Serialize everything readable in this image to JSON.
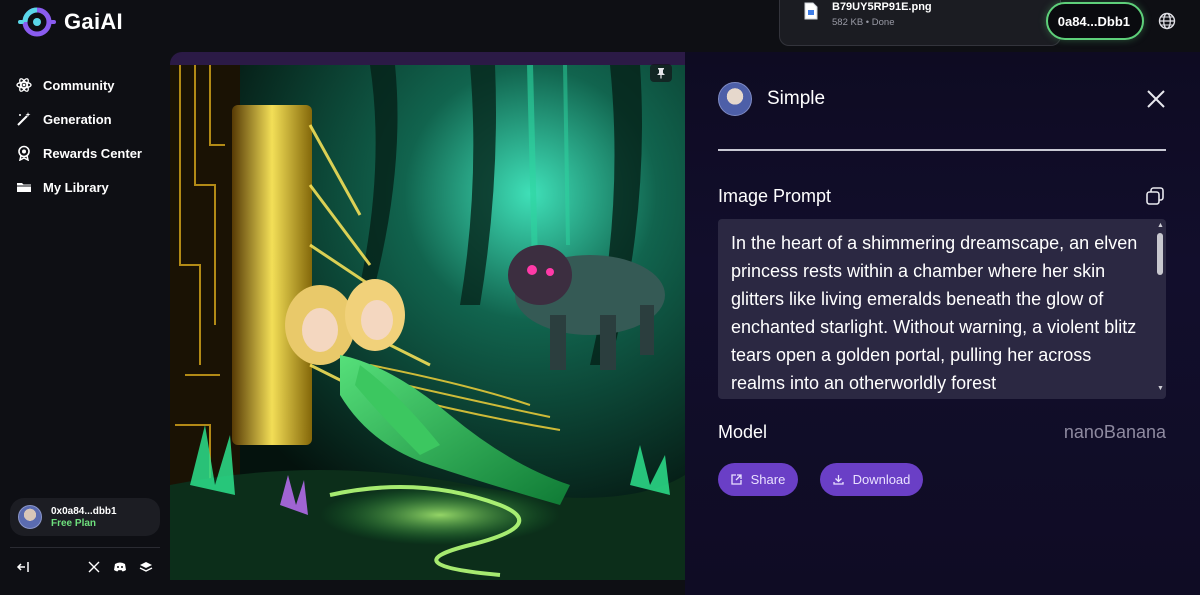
{
  "app": {
    "name": "GaiAI"
  },
  "download_popup": {
    "filename": "B79UY5RP91E.png",
    "meta": "582 KB • Done"
  },
  "header": {
    "wallet_label": "0a84...Dbb1"
  },
  "sidebar": {
    "items": [
      {
        "label": "Community",
        "icon": "atom-icon"
      },
      {
        "label": "Generation",
        "icon": "magic-wand-icon"
      },
      {
        "label": "Rewards Center",
        "icon": "medal-icon"
      },
      {
        "label": "My Library",
        "icon": "folder-icon"
      }
    ],
    "user": {
      "address": "0x0a84...dbb1",
      "plan": "Free Plan"
    },
    "footer_icons": [
      "collapse-icon",
      "x-icon",
      "discord-icon",
      "layers-icon"
    ]
  },
  "detail": {
    "style_name": "Simple",
    "prompt_label": "Image Prompt",
    "prompt_text": "In the heart of a shimmering dreamscape, an elven princess rests within a chamber where her skin glitters like living emeralds beneath the glow of enchanted starlight. Without warning, a violent blitz tears open a golden portal, pulling her across realms into an otherworldly forest",
    "model_label": "Model",
    "model_value": "nanoBanana",
    "share_label": "Share",
    "download_label": "Download"
  },
  "colors": {
    "accent_green": "#5ed07a",
    "plan_green": "#6ee07d",
    "button_purple": "#6a3fc6",
    "panel_bg": "#120e2c"
  }
}
